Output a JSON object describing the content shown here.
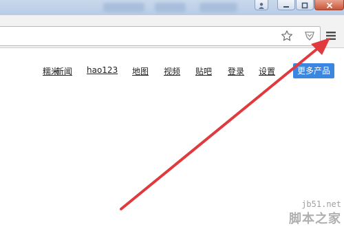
{
  "nav": {
    "links": [
      "糯米",
      "新闻",
      "hao123",
      "地图",
      "视频",
      "贴吧",
      "登录",
      "设置"
    ],
    "more_button": "更多产品"
  },
  "toolbar": {
    "bookmark_icon": "star-icon",
    "extension_icon": "shield-icon",
    "menu_icon": "hamburger-menu-icon"
  },
  "window_controls": [
    "user-icon",
    "minimize-icon",
    "maximize-icon",
    "close-icon"
  ],
  "annotation": {
    "arrow_color": "#e0393e",
    "arrow_icon": "red-arrow-icon"
  },
  "watermark": {
    "line1": "jb51.net",
    "line2": "脚本之家"
  }
}
